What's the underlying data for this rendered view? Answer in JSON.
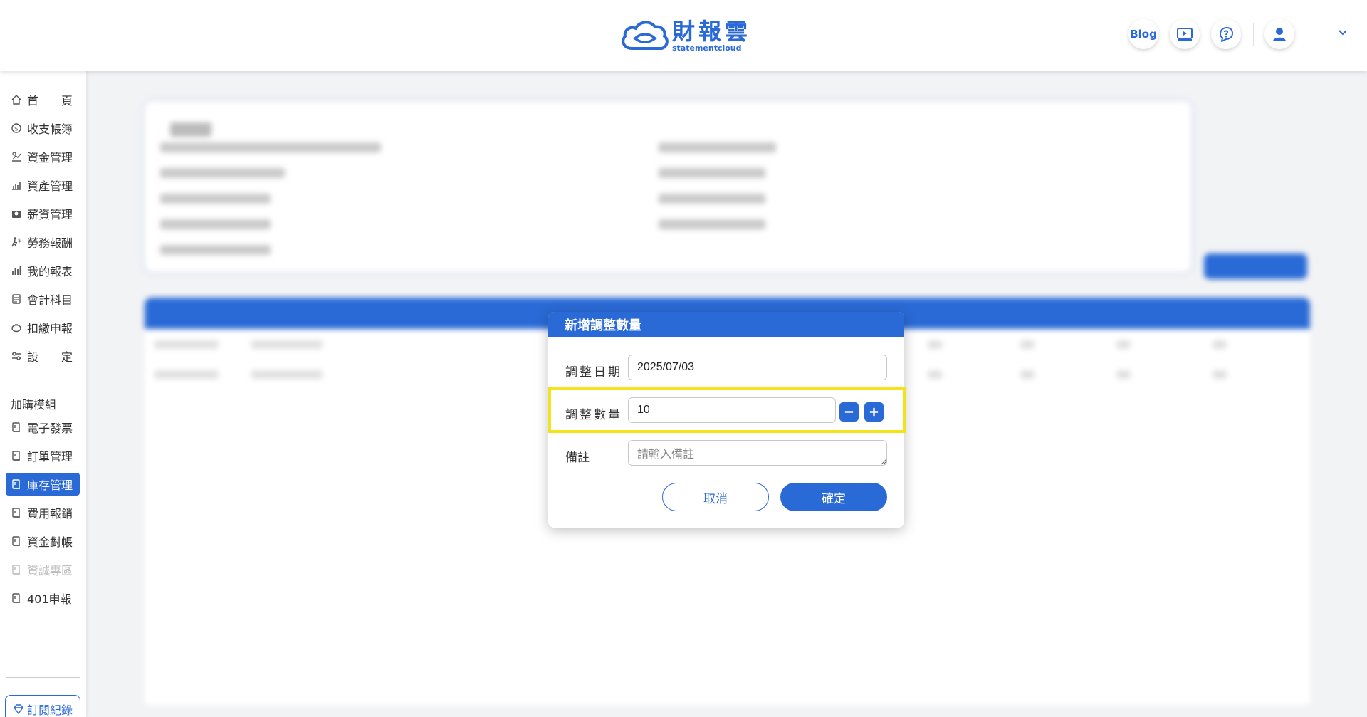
{
  "header": {
    "logo_cn": "財報雲",
    "logo_en": "statementcloud",
    "blog_label": "Blog"
  },
  "sidebar": {
    "items": [
      {
        "label": "首　　頁",
        "icon": "home-icon"
      },
      {
        "label": "收支帳簿",
        "icon": "coin-icon"
      },
      {
        "label": "資金管理",
        "icon": "fund-icon"
      },
      {
        "label": "資產管理",
        "icon": "asset-chart-icon"
      },
      {
        "label": "薪資管理",
        "icon": "salary-icon"
      },
      {
        "label": "勞務報酬",
        "icon": "labor-icon"
      },
      {
        "label": "我的報表",
        "icon": "bar-chart-icon"
      },
      {
        "label": "會計科目",
        "icon": "ledger-icon"
      },
      {
        "label": "扣繳申報",
        "icon": "piggy-icon"
      },
      {
        "label": "設　　定",
        "icon": "settings-sliders-icon"
      }
    ],
    "addon_heading": "加購模組",
    "addons": [
      {
        "label": "電子發票",
        "state": "normal"
      },
      {
        "label": "訂單管理",
        "state": "normal"
      },
      {
        "label": "庫存管理",
        "state": "active"
      },
      {
        "label": "費用報銷",
        "state": "normal"
      },
      {
        "label": "資金對帳",
        "state": "normal"
      },
      {
        "label": "資誠專區",
        "state": "disabled"
      },
      {
        "label": "401申報",
        "state": "normal"
      }
    ],
    "subscription_label": "訂閱紀錄"
  },
  "modal": {
    "title": "新增調整數量",
    "date_label": "調整日期",
    "date_value": "2025/07/03",
    "qty_label": "調整數量",
    "qty_value": "10",
    "note_label": "備註",
    "note_placeholder": "請輸入備註",
    "cancel_label": "取消",
    "confirm_label": "確定"
  },
  "colors": {
    "primary": "#2a6ad6",
    "highlight": "#f4e31b"
  }
}
